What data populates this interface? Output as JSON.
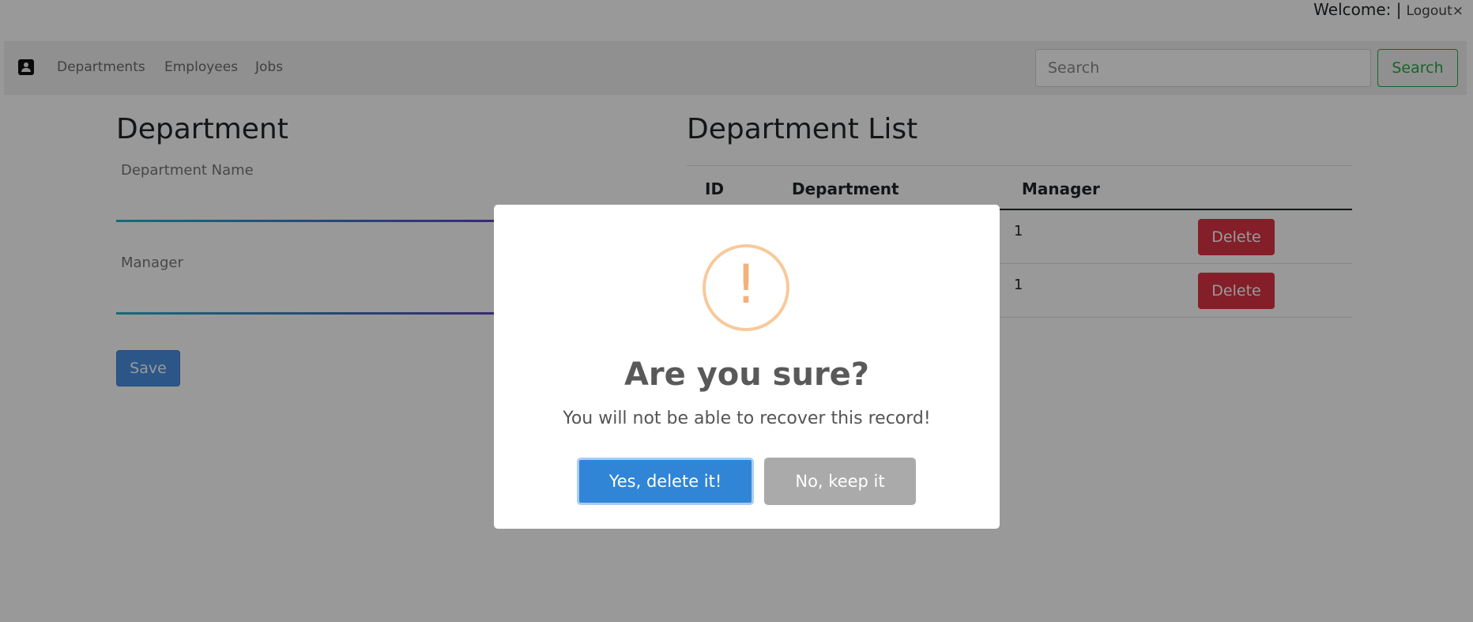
{
  "topbar": {
    "welcome": "Welcome: |",
    "logout": "Logout",
    "logout_icon": "×"
  },
  "navbar": {
    "brand_icon": "contact-card-icon",
    "links": [
      "Departments",
      "Employees",
      "Jobs"
    ],
    "search_placeholder": "Search",
    "search_button": "Search"
  },
  "form": {
    "title": "Department",
    "fields": [
      {
        "label": "Department Name",
        "value": ""
      },
      {
        "label": "Manager",
        "value": ""
      }
    ],
    "save_label": "Save"
  },
  "list": {
    "title": "Department List",
    "columns": [
      "ID",
      "Department",
      "Manager"
    ],
    "rows": [
      {
        "id": "",
        "department": "",
        "manager": "1",
        "action": "Delete"
      },
      {
        "id": "",
        "department": "",
        "manager": "1",
        "action": "Delete"
      }
    ]
  },
  "dialog": {
    "icon": "!",
    "title": "Are you sure?",
    "text": "You will not be able to recover this record!",
    "confirm_label": "Yes, delete it!",
    "cancel_label": "No, keep it",
    "colors": {
      "confirm": "#3085d6",
      "cancel": "#aaaaaa",
      "warning": "#f8bb86"
    }
  }
}
